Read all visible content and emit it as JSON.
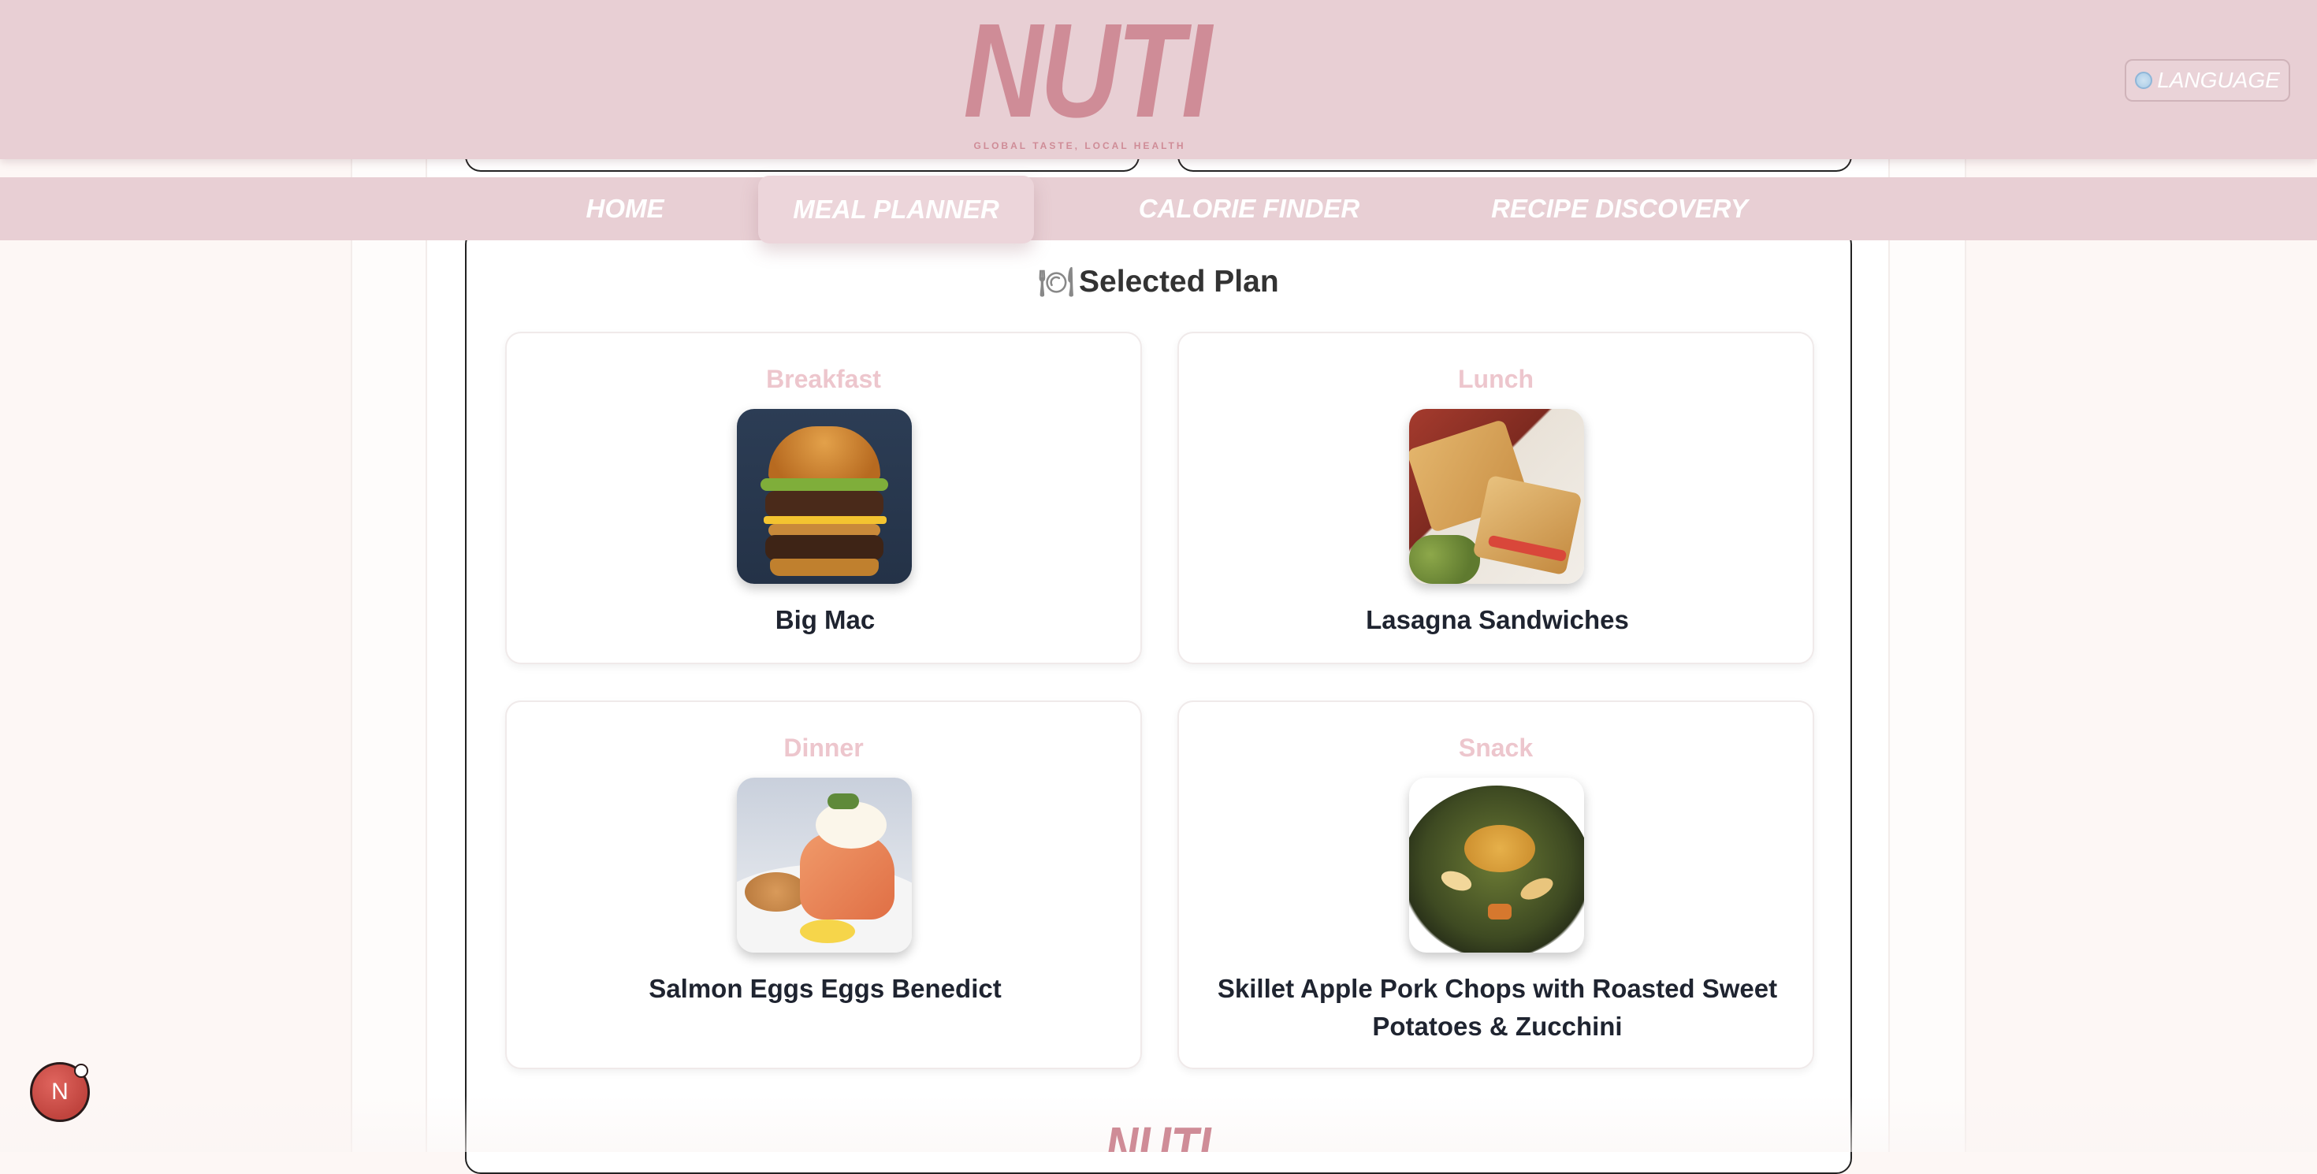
{
  "header": {
    "logo_text": "NUTI",
    "tagline": "GLOBAL TASTE, LOCAL HEALTH",
    "language_label": "LANGUAGE"
  },
  "nav": {
    "items": [
      {
        "label": "HOME",
        "active": false
      },
      {
        "label": "MEAL PLANNER",
        "active": true
      },
      {
        "label": "CALORIE FINDER",
        "active": false
      },
      {
        "label": "RECIPE DISCOVERY",
        "active": false
      }
    ]
  },
  "plan": {
    "title": "Selected Plan",
    "meals": [
      {
        "label": "Breakfast",
        "name": "Big Mac"
      },
      {
        "label": "Lunch",
        "name": "Lasagna Sandwiches"
      },
      {
        "label": "Dinner",
        "name": "Salmon Eggs Eggs Benedict"
      },
      {
        "label": "Snack",
        "name": "Skillet Apple Pork Chops with Roasted Sweet Potatoes & Zucchini"
      }
    ]
  },
  "footer": {
    "logo_text": "NUTI"
  },
  "fab": {
    "label": "N"
  },
  "colors": {
    "header_bg": "#e8cfd4",
    "logo": "#cf8c97",
    "meal_label": "#edc6cd",
    "fab": "#c0443e"
  }
}
